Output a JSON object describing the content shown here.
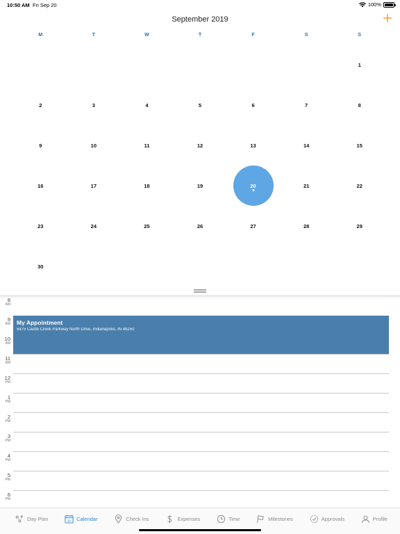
{
  "status_bar": {
    "time": "10:50 AM",
    "date": "Fri Sep 20",
    "battery": "100%"
  },
  "header": {
    "title": "September 2019",
    "add_icon": "plus-icon",
    "accent_color": "#f29b38"
  },
  "weekdays": [
    "M",
    "T",
    "W",
    "T",
    "F",
    "S",
    "S"
  ],
  "calendar": {
    "days": [
      "",
      "",
      "",
      "",
      "",
      "",
      "1",
      "2",
      "3",
      "4",
      "5",
      "6",
      "7",
      "8",
      "9",
      "10",
      "11",
      "12",
      "13",
      "14",
      "15",
      "16",
      "17",
      "18",
      "19",
      "20",
      "21",
      "22",
      "23",
      "24",
      "25",
      "26",
      "27",
      "28",
      "29",
      "30",
      "",
      "",
      "",
      "",
      "",
      ""
    ],
    "selected_day": "20",
    "selected_color": "#5fa6e4"
  },
  "timeline": {
    "hours": [
      {
        "h": "8",
        "ap": "AM"
      },
      {
        "h": "9",
        "ap": "AM"
      },
      {
        "h": "10",
        "ap": "AM"
      },
      {
        "h": "11",
        "ap": "AM"
      },
      {
        "h": "12",
        "ap": "PM"
      },
      {
        "h": "1",
        "ap": "PM"
      },
      {
        "h": "2",
        "ap": "PM"
      },
      {
        "h": "3",
        "ap": "PM"
      },
      {
        "h": "4",
        "ap": "PM"
      },
      {
        "h": "5",
        "ap": "PM"
      },
      {
        "h": "6",
        "ap": "PM"
      }
    ],
    "appointment": {
      "title": "My Appointment",
      "address": "5875 Castle Creek Parkway North Drive, Indianapolis, IN 46250",
      "color": "#4a7eac"
    }
  },
  "tabbar": {
    "active_color": "#2a86d8",
    "calendar_icon_day": "20",
    "tabs": [
      {
        "label": "Day Plan",
        "icon": "day-plan-icon"
      },
      {
        "label": "Calendar",
        "icon": "calendar-icon",
        "active": true
      },
      {
        "label": "Check Ins",
        "icon": "location-pin-icon"
      },
      {
        "label": "Expenses",
        "icon": "dollar-icon"
      },
      {
        "label": "Time",
        "icon": "clock-icon"
      },
      {
        "label": "Milestones",
        "icon": "flag-icon"
      },
      {
        "label": "Approvals",
        "icon": "approval-check-icon"
      },
      {
        "label": "Profile",
        "icon": "profile-icon"
      }
    ]
  }
}
